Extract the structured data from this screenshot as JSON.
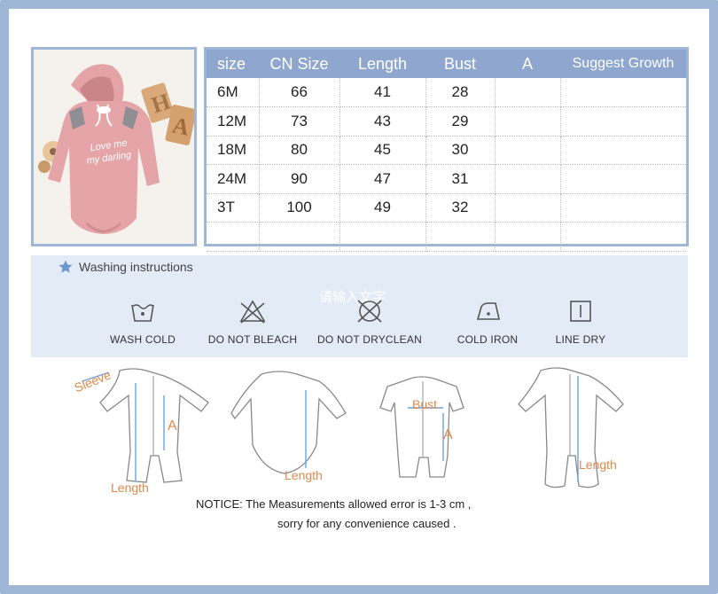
{
  "size_table": {
    "headers": [
      "size",
      "CN Size",
      "Length",
      "Bust",
      "A",
      "Suggest Growth"
    ],
    "rows": [
      [
        "6M",
        "66",
        "41",
        "28",
        "",
        ""
      ],
      [
        "12M",
        "73",
        "43",
        "29",
        "",
        ""
      ],
      [
        "18M",
        "80",
        "45",
        "30",
        "",
        ""
      ],
      [
        "24M",
        "90",
        "47",
        "31",
        "",
        ""
      ],
      [
        "3T",
        "100",
        "49",
        "32",
        "",
        ""
      ],
      [
        "",
        "",
        "",
        "",
        "",
        ""
      ]
    ]
  },
  "photo": {
    "print_text_1": "Love me",
    "print_text_2": "my darling",
    "letters": "HA"
  },
  "washing": {
    "title": "Washing instructions",
    "watermark": "请输入文字",
    "items": [
      {
        "label": "WASH COLD",
        "icon": "wash-cold-icon"
      },
      {
        "label": "DO NOT BLEACH",
        "icon": "no-bleach-icon"
      },
      {
        "label": "DO NOT DRYCLEAN",
        "icon": "no-dryclean-icon"
      },
      {
        "label": "COLD IRON",
        "icon": "cold-iron-icon"
      },
      {
        "label": "LINE DRY",
        "icon": "line-dry-icon"
      }
    ]
  },
  "diagrams": {
    "sleeve": "Sleeve",
    "a": "A",
    "length": "Length",
    "bust": "Bust"
  },
  "notice": {
    "line1": "NOTICE:   The Measurements allowed error is 1-3 cm ,",
    "line2": "sorry for any convenience caused ."
  },
  "colors": {
    "frame": "#9fb6d6",
    "header": "#8fa7cf",
    "panel": "#e3ebf6",
    "measure_line": "#6fa0de",
    "measure_label": "#e08a4a",
    "romper": "#e4a4a8"
  }
}
